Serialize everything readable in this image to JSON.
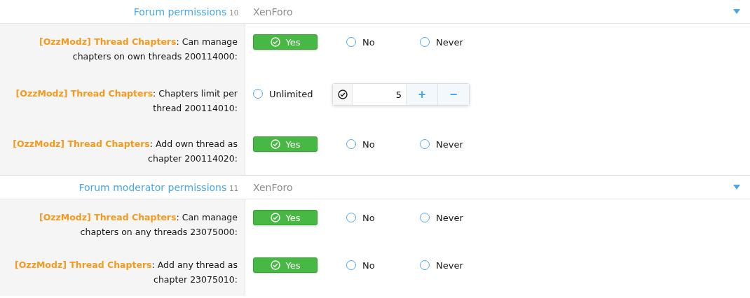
{
  "sections": [
    {
      "title": "Forum permissions",
      "count": "10",
      "source": "XenForo",
      "expanded": true,
      "rows": [
        {
          "kind": "radio",
          "label": "**[OzzModz] Thread Chapters**: Can manage chapters on own threads 200114000:",
          "options": [
            {
              "label": "Yes",
              "selected": true
            },
            {
              "label": "No",
              "selected": false
            },
            {
              "label": "Never",
              "selected": false
            }
          ]
        },
        {
          "kind": "number",
          "label": "**[OzzModz] Thread Chapters**: Chapters limit per thread 200114010:",
          "options": [
            {
              "label": "Unlimited",
              "selected": false
            }
          ],
          "checked": true,
          "value": "5",
          "plus": "+",
          "minus": "−"
        },
        {
          "kind": "radio",
          "label": "**[OzzModz] Thread Chapters**: Add own thread as chapter 200114020:",
          "options": [
            {
              "label": "Yes",
              "selected": true
            },
            {
              "label": "No",
              "selected": false
            },
            {
              "label": "Never",
              "selected": false
            }
          ]
        }
      ]
    },
    {
      "title": "Forum moderator permissions",
      "count": "11",
      "source": "XenForo",
      "expanded": true,
      "rows": [
        {
          "kind": "radio",
          "label": "**[OzzModz] Thread Chapters**: Can manage chapters on any threads 23075000:",
          "options": [
            {
              "label": "Yes",
              "selected": true
            },
            {
              "label": "No",
              "selected": false
            },
            {
              "label": "Never",
              "selected": false
            }
          ]
        },
        {
          "kind": "radio",
          "label": "**[OzzModz] Thread Chapters**: Add any thread as chapter 23075010:",
          "options": [
            {
              "label": "Yes",
              "selected": true
            },
            {
              "label": "No",
              "selected": false
            },
            {
              "label": "Never",
              "selected": false
            }
          ]
        }
      ]
    }
  ]
}
